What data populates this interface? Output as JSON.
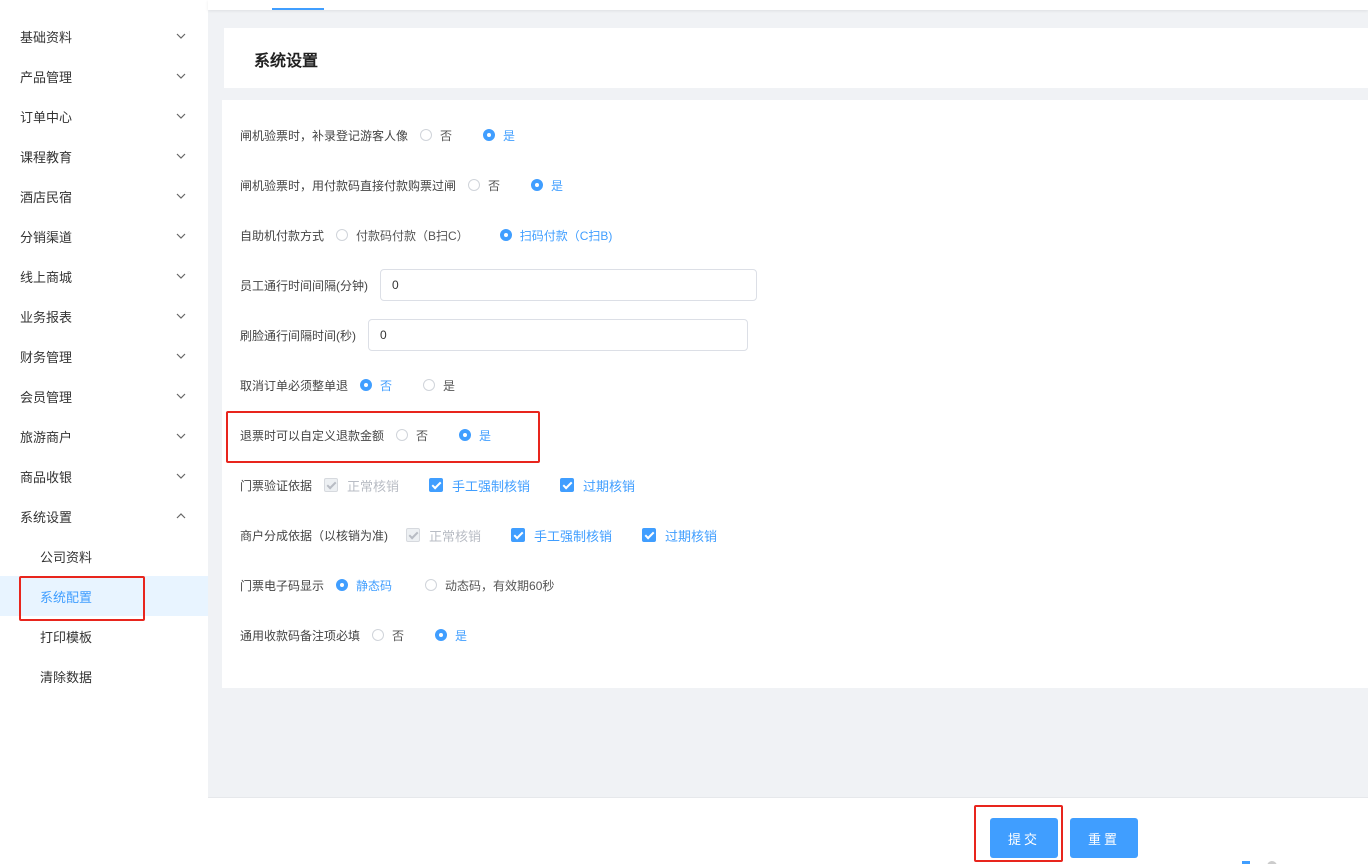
{
  "sidebar": {
    "menus": [
      {
        "label": "基础资料"
      },
      {
        "label": "产品管理"
      },
      {
        "label": "订单中心"
      },
      {
        "label": "课程教育"
      },
      {
        "label": "酒店民宿"
      },
      {
        "label": "分销渠道"
      },
      {
        "label": "线上商城"
      },
      {
        "label": "业务报表"
      },
      {
        "label": "财务管理"
      },
      {
        "label": "会员管理"
      },
      {
        "label": "旅游商户"
      },
      {
        "label": "商品收银"
      },
      {
        "label": "系统设置"
      }
    ],
    "submenu": [
      {
        "label": "公司资料"
      },
      {
        "label": "系统配置"
      },
      {
        "label": "打印模板"
      },
      {
        "label": "清除数据"
      }
    ],
    "active_submenu": "系统配置"
  },
  "page": {
    "title": "系统设置"
  },
  "form": {
    "gate_photo": {
      "label": "闸机验票时，补录登记游客人像",
      "options": [
        "否",
        "是"
      ],
      "selected": "是"
    },
    "gate_paycode": {
      "label": "闸机验票时，用付款码直接付款购票过闸",
      "options": [
        "否",
        "是"
      ],
      "selected": "是"
    },
    "kiosk_pay": {
      "label": "自助机付款方式",
      "options": [
        "付款码付款（B扫C）",
        "扫码付款（C扫B)"
      ],
      "selected": "扫码付款（C扫B)"
    },
    "staff_interval": {
      "label": "员工通行时间间隔(分钟)",
      "value": "0"
    },
    "face_interval": {
      "label": "刷脸通行间隔时间(秒)",
      "value": "0"
    },
    "cancel_whole": {
      "label": "取消订单必须整单退",
      "options": [
        "否",
        "是"
      ],
      "selected": "否"
    },
    "custom_refund": {
      "label": "退票时可以自定义退款金额",
      "options": [
        "否",
        "是"
      ],
      "selected": "是"
    },
    "ticket_verify": {
      "label": "门票验证依据",
      "options": [
        "正常核销",
        "手工强制核销",
        "过期核销"
      ]
    },
    "merchant_split": {
      "label": "商户分成依据（以核销为准)",
      "options": [
        "正常核销",
        "手工强制核销",
        "过期核销"
      ]
    },
    "eticket_code": {
      "label": "门票电子码显示",
      "options": [
        "静态码",
        "动态码，有效期60秒"
      ],
      "selected": "静态码"
    },
    "remark_required": {
      "label": "通用收款码备注项必填",
      "options": [
        "否",
        "是"
      ],
      "selected": "是"
    }
  },
  "actions": {
    "submit": "提交",
    "reset": "重置"
  },
  "colors": {
    "primary": "#409eff",
    "highlight": "#e8251d"
  }
}
